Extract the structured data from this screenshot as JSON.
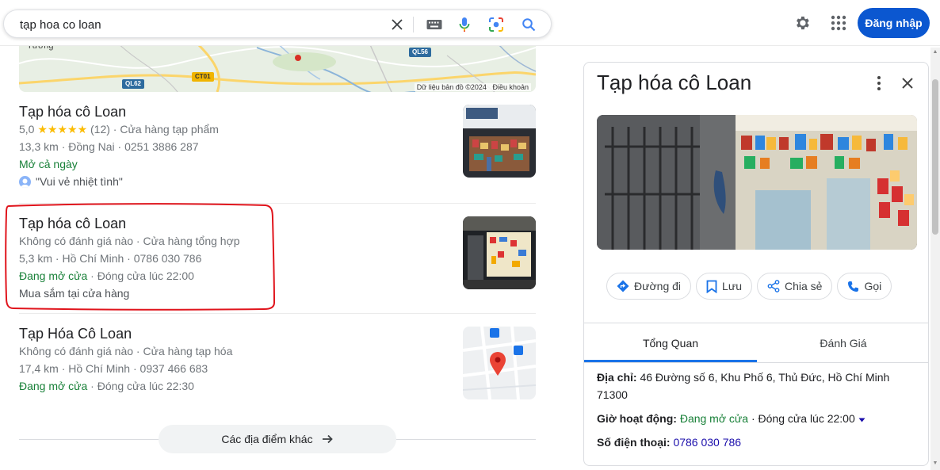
{
  "search": {
    "query": "tạp hoa co loan",
    "placeholder": ""
  },
  "header": {
    "login_label": "Đăng nhập"
  },
  "map": {
    "place_labels": [
      "Tương"
    ],
    "road_labels": [
      "QL56",
      "QL62",
      "CT01"
    ],
    "attribution": "Dữ liệu bản đồ ©2024",
    "terms": "Điều khoản"
  },
  "results": [
    {
      "title": "Tạp hóa cô Loan",
      "rating": "5,0",
      "stars": "★★★★★",
      "review_count": "(12)",
      "category": "Cửa hàng tạp phẩm",
      "distance": "13,3 km",
      "area": "Đồng Nai",
      "phone": "0251 3886 287",
      "status": "Mở cả ngày",
      "review": "\"Vui vẻ nhiệt tình\""
    },
    {
      "title": "Tạp hóa cô Loan",
      "rating_text": "Không có đánh giá nào",
      "category": "Cửa hàng tổng hợp",
      "distance": "5,3 km",
      "area": "Hồ Chí Minh",
      "phone": "0786 030 786",
      "status": "Đang mở cửa",
      "closing": "Đóng cửa lúc 22:00",
      "extra": "Mua sắm tại cửa hàng"
    },
    {
      "title": "Tạp Hóa Cô Loan",
      "rating_text": "Không có đánh giá nào",
      "category": "Cửa hàng tạp hóa",
      "distance": "17,4 km",
      "area": "Hồ Chí Minh",
      "phone": "0937 466 683",
      "status": "Đang mở cửa",
      "closing": "Đóng cửa lúc 22:30"
    }
  ],
  "more_places_label": "Các địa điểm khác",
  "panel": {
    "title": "Tạp hóa cô Loan",
    "actions": [
      "Đường đi",
      "Lưu",
      "Chia sẻ",
      "Gọi"
    ],
    "tabs": [
      "Tổng Quan",
      "Đánh Giá"
    ],
    "address_label": "Địa chỉ:",
    "address": "46 Đường số 6, Khu Phố 6, Thủ Đức, Hồ Chí Minh 71300",
    "hours_label": "Giờ hoạt động:",
    "hours_status": "Đang mở cửa",
    "hours_closing": "Đóng cửa lúc 22:00",
    "phone_label": "Số điện thoại:",
    "phone": "0786 030 786"
  },
  "colors": {
    "accent": "#0b57d0",
    "open": "#188038",
    "highlight": "#e0141c",
    "link": "#1a0dab"
  }
}
